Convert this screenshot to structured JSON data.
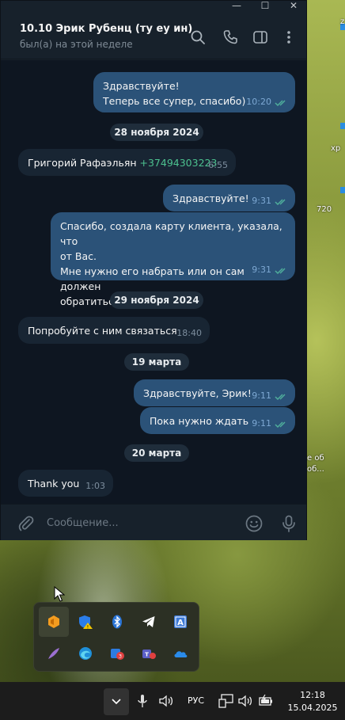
{
  "window": {
    "minimize_glyph": "—",
    "maximize_glyph": "☐",
    "close_glyph": "✕"
  },
  "chat": {
    "title": "10.10 Эрик Рубенц (ту еу ин)",
    "status": "был(а) на этой неделе",
    "header_icons": [
      "search-icon",
      "phone-icon",
      "sidebar-toggle-icon",
      "more-vertical-icon"
    ]
  },
  "messages": [
    {
      "dir": "out",
      "lines": [
        "Здравствуйте!",
        "Теперь все супер, спасибо)"
      ],
      "time": "10:20",
      "read": true
    },
    {
      "type": "date",
      "label": "28 ноября 2024"
    },
    {
      "dir": "in",
      "text": "Григорий Рафаэльян ",
      "phone": "+37494303223",
      "time": "6:55"
    },
    {
      "dir": "out",
      "text": "Здравствуйте!",
      "time": "9:31",
      "read": true
    },
    {
      "dir": "out",
      "lines": [
        "Спасибо, создала карту клиента, указала, что",
        "от Вас.",
        "Мне нужно его набрать или он сам должен",
        "обратиться?"
      ],
      "time": "9:31",
      "read": true
    },
    {
      "type": "date",
      "label": "29 ноября 2024"
    },
    {
      "dir": "in",
      "text": "Попробуйте с ним связаться",
      "time": "18:40"
    },
    {
      "type": "date",
      "label": "19 марта"
    },
    {
      "dir": "out",
      "text": "Здравствуйте, Эрик!",
      "time": "9:11",
      "read": true
    },
    {
      "dir": "out",
      "text": "Пока нужно ждать",
      "time": "9:11",
      "read": true
    },
    {
      "type": "date",
      "label": "20 марта"
    },
    {
      "dir": "in",
      "text": "Thank you",
      "time": "1:03"
    }
  ],
  "composer": {
    "placeholder": "Сообщение...",
    "icons": [
      "attach-icon",
      "emoji-icon",
      "microphone-icon"
    ]
  },
  "desktop_fragments": [
    "z",
    "xp",
    "720",
    "е об",
    "об..."
  ],
  "tray_flyout": {
    "icons": [
      "sublime-merge-icon",
      "defender-warning-icon",
      "bluetooth-icon",
      "telegram-icon",
      "text-app-icon",
      "pen-app-icon",
      "edge-icon",
      "calendar-badge-icon",
      "teams-icon",
      "onedrive-icon"
    ]
  },
  "taskbar": {
    "language": "РУС",
    "time": "12:18",
    "date": "15.04.2025"
  }
}
